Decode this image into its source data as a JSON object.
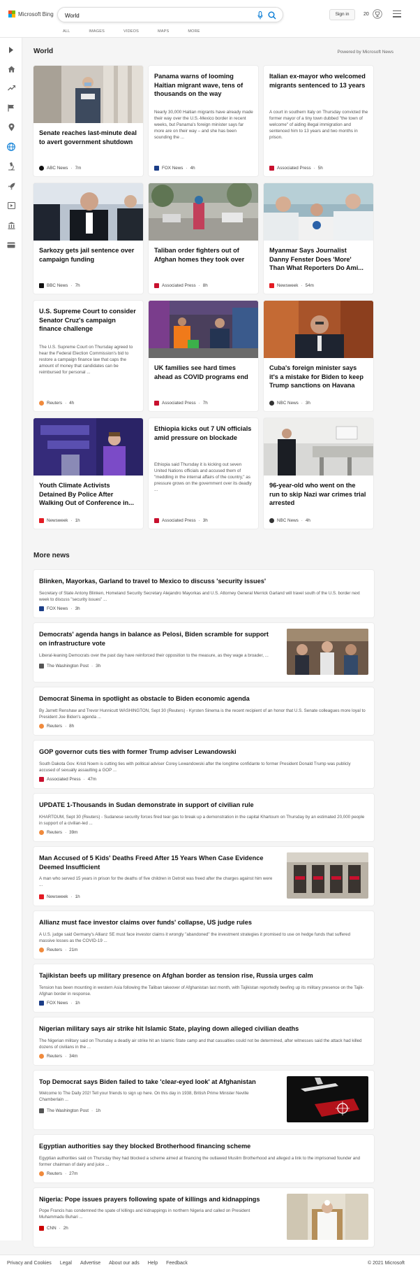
{
  "header": {
    "logo_text": "Microsoft Bing",
    "search_value": "World",
    "scopes": [
      "ALL",
      "IMAGES",
      "VIDEOS",
      "MAPS",
      "MORE"
    ],
    "signin_label": "Sign in",
    "points": "20"
  },
  "section": {
    "title": "World",
    "powered_by": "Powered by Microsoft News"
  },
  "cards": [
    {
      "title": "Senate reaches last-minute deal to avert government shutdown",
      "source": "ABC News",
      "time": "7m",
      "desc": ""
    },
    {
      "title": "Panama warns of looming Haitian migrant wave, tens of thousands on the way",
      "source": "FOX News",
      "time": "4h",
      "desc": "Nearly 30,000 Haitian migrants have already made their way over the U.S.-Mexico border in recent weeks, but Panama's foreign minister says far more are on their way – and she has been sounding the ..."
    },
    {
      "title": "Italian ex-mayor who welcomed migrants sentenced to 13 years",
      "source": "Associated Press",
      "time": "5h",
      "desc": "A court in southern Italy on Thursday convicted the former mayor of a tiny town dubbed \"the town of welcome\" of aiding illegal immigration and sentenced him to 13 years and two months in prison."
    },
    {
      "title": "Sarkozy gets jail sentence over campaign funding",
      "source": "BBC News",
      "time": "7h",
      "desc": ""
    },
    {
      "title": "Taliban order fighters out of Afghan homes they took over",
      "source": "Associated Press",
      "time": "8h",
      "desc": ""
    },
    {
      "title": "Myanmar Says Journalist Danny Fenster Does 'More' Than What Reporters Do Ami...",
      "source": "Newsweek",
      "time": "54m",
      "desc": ""
    },
    {
      "title": "U.S. Supreme Court to consider Senator Cruz's campaign finance challenge",
      "source": "Reuters",
      "time": "4h",
      "desc": "The U.S. Supreme Court on Thursday agreed to hear the Federal Election Commission's bid to restore a campaign finance law that caps the amount of money that candidates can be reimbursed for personal ..."
    },
    {
      "title": "UK families see hard times ahead as COVID programs end",
      "source": "Associated Press",
      "time": "7h",
      "desc": ""
    },
    {
      "title": "Cuba's foreign minister says it's a mistake for Biden to keep Trump sanctions on Havana",
      "source": "NBC News",
      "time": "3h",
      "desc": ""
    },
    {
      "title": "Youth Climate Activists Detained By Police After Walking Out of Conference in...",
      "source": "Newsweek",
      "time": "1h",
      "desc": ""
    },
    {
      "title": "Ethiopia kicks out 7 UN officials amid pressure on blockade",
      "source": "Associated Press",
      "time": "3h",
      "desc": "Ethiopia said Thursday it is kicking out seven United Nations officials and accused them of \"meddling in the internal affairs of the country,\" as pressure grows on the government over its deadly ..."
    },
    {
      "title": "96-year-old who went on the run to skip Nazi war crimes trial arrested",
      "source": "NBC News",
      "time": "4h",
      "desc": ""
    }
  ],
  "more_news": {
    "title": "More news",
    "items": [
      {
        "title": "Blinken, Mayorkas, Garland to travel to Mexico to discuss 'security issues'",
        "desc": "Secretary of State Antony Blinken, Homeland Security Secretary Alejandro Mayorkas and U.S. Attorney General Merrick Garland will travel south of the U.S. border next week to discuss \"security issues\" ...",
        "source": "FOX News",
        "time": "3h"
      },
      {
        "title": "Democrats' agenda hangs in balance as Pelosi, Biden scramble for support on infrastructure vote",
        "desc": "Liberal-leaning Democrats over the past day have reinforced their opposition to the measure, as they wage a broader, ...",
        "source": "The Washington Post",
        "time": "3h"
      },
      {
        "title": "Democrat Sinema in spotlight as obstacle to Biden economic agenda",
        "desc": "By Jarrett Renshaw and Trevor Hunnicutt WASHINGTON, Sept 30 (Reuters) - Kyrsten Sinema is the recent recipient of an honor that U.S. Senate colleagues more loyal to President Joe Biden's agenda ...",
        "source": "Reuters",
        "time": "8h"
      },
      {
        "title": "GOP governor cuts ties with former Trump adviser Lewandowski",
        "desc": "South Dakota Gov. Kristi Noem is cutting ties with political adviser Corey Lewandowski after the longtime confidante to former President Donald Trump was publicly accused of sexually assaulting a GOP ...",
        "source": "Associated Press",
        "time": "47m"
      },
      {
        "title": "UPDATE 1-Thousands in Sudan demonstrate in support of civilian rule",
        "desc": "KHARTOUM, Sept 30 (Reuters) - Sudanese security forces fired tear gas to break up a demonstration in the capital Khartoum on Thursday by an estimated 20,000 people in support of a civilian-led ...",
        "source": "Reuters",
        "time": "39m"
      },
      {
        "title": "Man Accused of 5 Kids' Deaths Freed After 15 Years When Case Evidence Deemed Insufficient",
        "desc": "A man who served 15 years in prison for the deaths of five children in Detroit was freed after the charges against him were ...",
        "source": "Newsweek",
        "time": "1h"
      },
      {
        "title": "Allianz must face investor claims over funds' collapse, US judge rules",
        "desc": "A U.S. judge said Germany's Allianz SE must face investor claims it wrongly \"abandoned\" the investment strategies it promised to use on hedge funds that suffered massive losses as the COVID-19 ...",
        "source": "Reuters",
        "time": "21m"
      },
      {
        "title": "Tajikistan beefs up military presence on Afghan border as tension rise, Russia urges calm",
        "desc": "Tension has been mounting in western Asia following the Taliban takeover of Afghanistan last month, with Tajikistan reportedly beefing up its military presence on the Tajik-Afghan border in response.",
        "source": "FOX News",
        "time": "1h"
      },
      {
        "title": "Nigerian military says air strike hit Islamic State, playing down alleged civilian deaths",
        "desc": "The Nigerian military said on Thursday a deadly air strike hit an Islamic State camp and that casualties could not be determined, after witnesses said the attack had killed dozens of civilians in the ...",
        "source": "Reuters",
        "time": "34m"
      },
      {
        "title": "Top Democrat says Biden failed to take 'clear-eyed look' at Afghanistan",
        "desc": "Welcome to The Daily 202! Tell your friends to sign up here. On this day in 1938, British Prime Minister Neville Chamberlain ...",
        "source": "The Washington Post",
        "time": "1h"
      },
      {
        "title": "Egyptian authorities say they blocked Brotherhood financing scheme",
        "desc": "Egyptian authorities said on Thursday they had blocked a scheme aimed at financing the outlawed Muslim Brotherhood and alleged a link to the imprisoned founder and former chairman of dairy and juice ...",
        "source": "Reuters",
        "time": "27m"
      },
      {
        "title": "Nigeria: Pope issues prayers following spate of killings and kidnappings",
        "desc": "Pope Francis has condemned the spate of killings and kidnappings in northern Nigeria and called on President Muhammadu Buhari ...",
        "source": "CNN",
        "time": "2h"
      }
    ]
  },
  "footer": {
    "links": [
      "Privacy and Cookies",
      "Legal",
      "Advertise",
      "About our ads",
      "Help",
      "Feedback"
    ],
    "copyright": "© 2021 Microsoft"
  }
}
